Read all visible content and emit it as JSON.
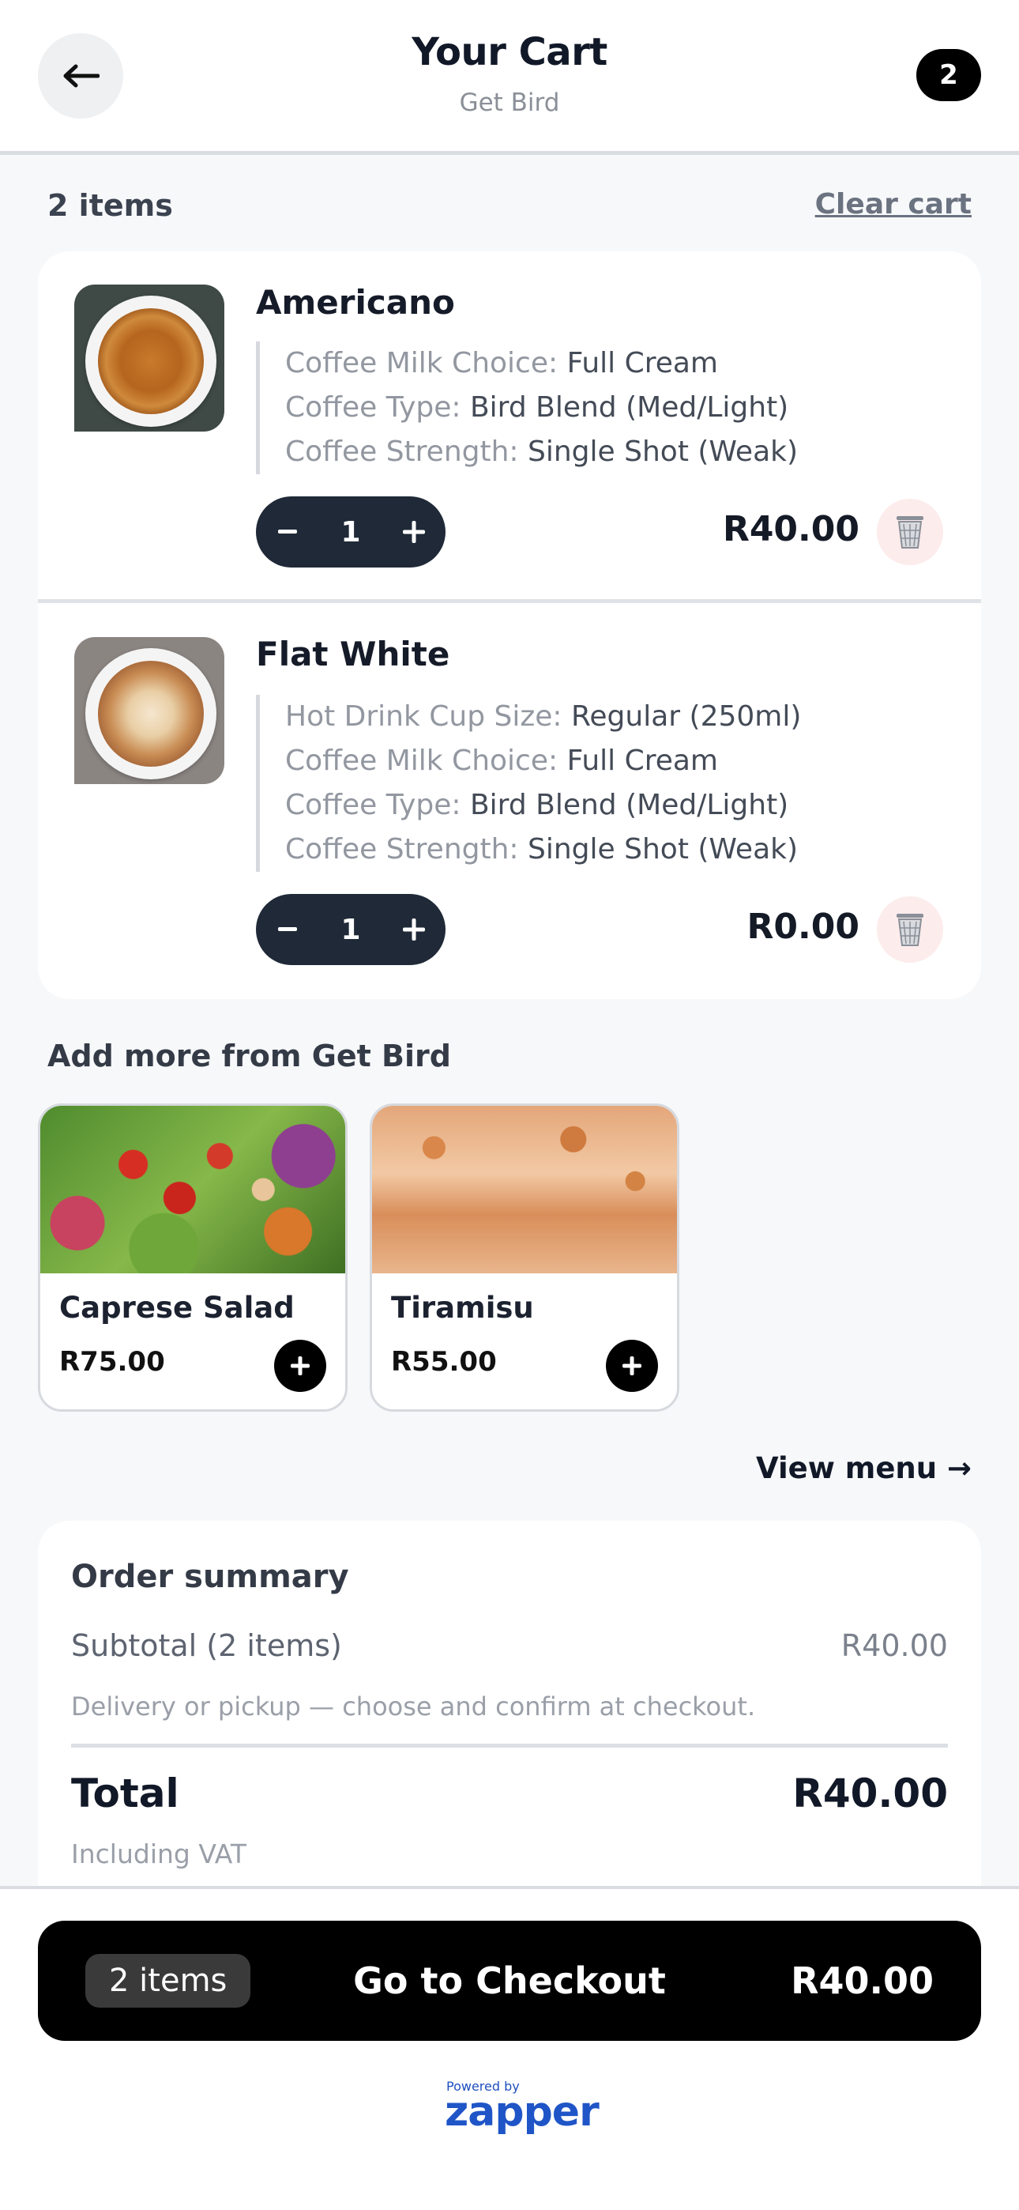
{
  "header": {
    "title": "Your Cart",
    "subtitle": "Get Bird",
    "cart_count": "2"
  },
  "cart": {
    "items_count_label": "2 items",
    "clear_label": "Clear cart",
    "items": [
      {
        "name": "Americano",
        "options": [
          {
            "key": "Coffee Milk Choice:",
            "value": "Full Cream"
          },
          {
            "key": "Coffee Type:",
            "value": "Bird Blend (Med/Light)"
          },
          {
            "key": "Coffee Strength:",
            "value": "Single Shot (Weak)"
          }
        ],
        "quantity": "1",
        "price": "R40.00"
      },
      {
        "name": "Flat White",
        "options": [
          {
            "key": "Hot Drink Cup Size:",
            "value": "Regular (250ml)"
          },
          {
            "key": "Coffee Milk Choice:",
            "value": "Full Cream"
          },
          {
            "key": "Coffee Type:",
            "value": "Bird Blend (Med/Light)"
          },
          {
            "key": "Coffee Strength:",
            "value": "Single Shot (Weak)"
          }
        ],
        "quantity": "1",
        "price": "R0.00"
      }
    ]
  },
  "add_more": {
    "title": "Add more from Get Bird",
    "products": [
      {
        "name": "Caprese Salad",
        "price": "R75.00"
      },
      {
        "name": "Tiramisu",
        "price": "R55.00"
      }
    ],
    "view_menu": "View menu →"
  },
  "summary": {
    "title": "Order summary",
    "subtotal_label": "Subtotal (2 items)",
    "subtotal_value": "R40.00",
    "note": "Delivery or pickup — choose and confirm at checkout.",
    "total_label": "Total",
    "total_value": "R40.00",
    "vat_note": "Including VAT"
  },
  "checkout": {
    "items_badge": "2 items",
    "label": "Go to Checkout",
    "total": "R40.00"
  },
  "footer": {
    "powered_by": "Powered by",
    "brand": "zapper"
  },
  "colors": {
    "accent": "#000000",
    "qty_bg": "#1f2937",
    "trash_bg": "#fdecec",
    "brand_blue": "#1f55c7"
  },
  "icons": {
    "back": "arrow-left-icon",
    "trash": "trash-icon",
    "plus": "plus-icon",
    "minus": "minus-icon"
  }
}
